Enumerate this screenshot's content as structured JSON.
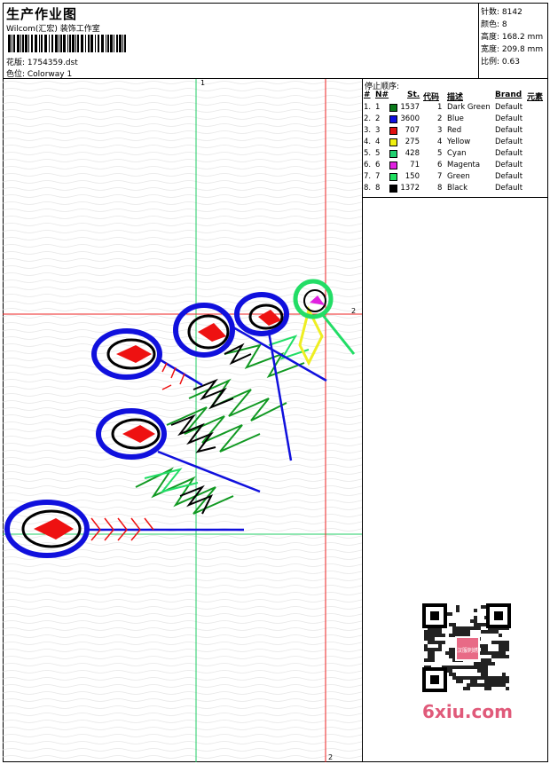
{
  "header": {
    "title": "生产作业图",
    "studio": "Wilcom(汇宏) 装饰工作室",
    "design_line": "花版: 1754359.dst",
    "color_line": "色位: Colorway 1"
  },
  "stats": [
    {
      "label": "针数",
      "value": "8142"
    },
    {
      "label": "颜色",
      "value": "8"
    },
    {
      "label": "高度",
      "value": "168.2 mm"
    },
    {
      "label": "宽度",
      "value": "209.8 mm"
    },
    {
      "label": "比例",
      "value": "0.63"
    }
  ],
  "stop_sequence": {
    "title": "停止顺序:",
    "headers": {
      "num": "#",
      "no": "N#",
      "st": "St.",
      "code": "代码",
      "desc": "描述",
      "brand": "Brand",
      "element": "元素"
    },
    "rows": [
      {
        "num": "1.",
        "no": "1",
        "color": "#0a7a1a",
        "st": "1537",
        "code": "1",
        "desc": "Dark Green",
        "brand": "Default"
      },
      {
        "num": "2.",
        "no": "2",
        "color": "#1010e0",
        "st": "3600",
        "code": "2",
        "desc": "Blue",
        "brand": "Default"
      },
      {
        "num": "3.",
        "no": "3",
        "color": "#e01010",
        "st": "707",
        "code": "3",
        "desc": "Red",
        "brand": "Default"
      },
      {
        "num": "4.",
        "no": "4",
        "color": "#f0f010",
        "st": "275",
        "code": "4",
        "desc": "Yellow",
        "brand": "Default"
      },
      {
        "num": "5.",
        "no": "5",
        "color": "#20d070",
        "st": "428",
        "code": "5",
        "desc": "Cyan",
        "brand": "Default"
      },
      {
        "num": "6.",
        "no": "6",
        "color": "#e020e0",
        "st": "71",
        "code": "6",
        "desc": "Magenta",
        "brand": "Default"
      },
      {
        "num": "7.",
        "no": "7",
        "color": "#20e060",
        "st": "150",
        "code": "7",
        "desc": "Green",
        "brand": "Default"
      },
      {
        "num": "8.",
        "no": "8",
        "color": "#000000",
        "st": "1372",
        "code": "8",
        "desc": "Black",
        "brand": "Default"
      }
    ]
  },
  "axis_labels": {
    "top": "1",
    "right": "2",
    "bottom": "2"
  },
  "watermark": "6xiu.com",
  "qr_badge": "汉服刺绣"
}
